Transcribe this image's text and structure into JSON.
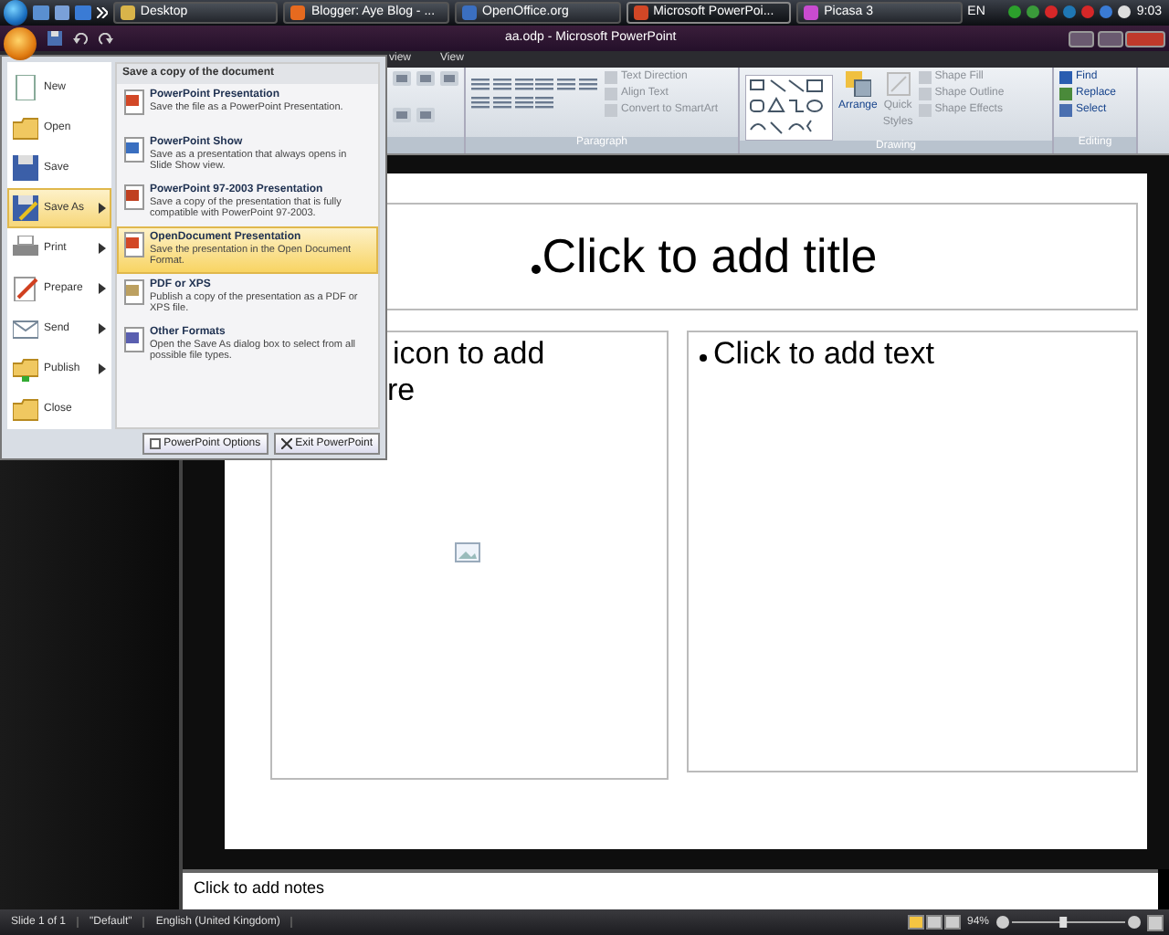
{
  "taskbar": {
    "tasks": [
      {
        "label": "Desktop",
        "kind": "folder",
        "selected": false
      },
      {
        "label": "Blogger: Aye Blog - ...",
        "kind": "browser",
        "selected": false
      },
      {
        "label": "OpenOffice.org",
        "kind": "office",
        "selected": false
      },
      {
        "label": "Microsoft PowerPoi...",
        "kind": "powerpoint",
        "selected": true
      },
      {
        "label": "Picasa 3",
        "kind": "picasa",
        "selected": false
      }
    ],
    "language": "EN",
    "clock": "9:03"
  },
  "window": {
    "title": "aa.odp - Microsoft PowerPoint"
  },
  "ribbon_tabs": [
    "view",
    "View"
  ],
  "ribbon": {
    "paragraph": {
      "buttons": [
        "Text Direction",
        "Align Text",
        "Convert to SmartArt"
      ],
      "label": "Paragraph"
    },
    "drawing": {
      "arrange": "Arrange",
      "quick_styles": [
        "Quick",
        "Styles"
      ],
      "buttons": [
        "Shape Fill",
        "Shape Outline",
        "Shape Effects"
      ],
      "label": "Drawing"
    },
    "editing": {
      "buttons": [
        "Find",
        "Replace",
        "Select"
      ],
      "label": "Editing"
    }
  },
  "slide": {
    "title": "Click to add title",
    "left_box": [
      "icon to add",
      "re"
    ],
    "right_box": "Click to add text"
  },
  "notes": {
    "placeholder": "Click to add notes"
  },
  "status_bar": {
    "items": [
      "Slide 1 of 1",
      "\"Default\"",
      "English (United Kingdom)"
    ],
    "zoom": "94%",
    "zoom_slider": {
      "level": 0.45
    }
  },
  "office_menu": {
    "items": [
      {
        "label": "New",
        "kind": "new",
        "submenu": false,
        "selected": false
      },
      {
        "label": "Open",
        "kind": "open",
        "submenu": false,
        "selected": false
      },
      {
        "label": "Save",
        "kind": "save",
        "submenu": false,
        "selected": false
      },
      {
        "label": "Save As",
        "kind": "saveas",
        "submenu": true,
        "selected": true
      },
      {
        "label": "Print",
        "kind": "print",
        "submenu": true,
        "selected": false
      },
      {
        "label": "Prepare",
        "kind": "prepare",
        "submenu": true,
        "selected": false
      },
      {
        "label": "Send",
        "kind": "send",
        "submenu": true,
        "selected": false
      },
      {
        "label": "Publish",
        "kind": "publish",
        "submenu": true,
        "selected": false
      },
      {
        "label": "Close",
        "kind": "close",
        "submenu": false,
        "selected": false
      }
    ],
    "submenu_title": "Save a copy of the document",
    "submenu": [
      {
        "title": "PowerPoint Presentation",
        "description": "Save the file as a PowerPoint Presentation.",
        "kind": "pptx",
        "selected": false
      },
      {
        "title": "PowerPoint Show",
        "description": "Save as a presentation that always opens in Slide Show view.",
        "kind": "show",
        "selected": false
      },
      {
        "title": "PowerPoint 97-2003 Presentation",
        "description": "Save a copy of the presentation that is fully compatible with PowerPoint 97-2003.",
        "kind": "ppt",
        "selected": false
      },
      {
        "title": "OpenDocument Presentation",
        "description": "Save the presentation in the Open Document Format.",
        "kind": "odp",
        "selected": true
      },
      {
        "title": "PDF or XPS",
        "description": "Publish a copy of the presentation as a PDF or XPS file.",
        "kind": "pdf",
        "selected": false
      },
      {
        "title": "Other Formats",
        "description": "Open the Save As dialog box to select from all possible file types.",
        "kind": "other",
        "selected": false
      }
    ],
    "footer_buttons": [
      "PowerPoint Options",
      "Exit PowerPoint"
    ]
  }
}
